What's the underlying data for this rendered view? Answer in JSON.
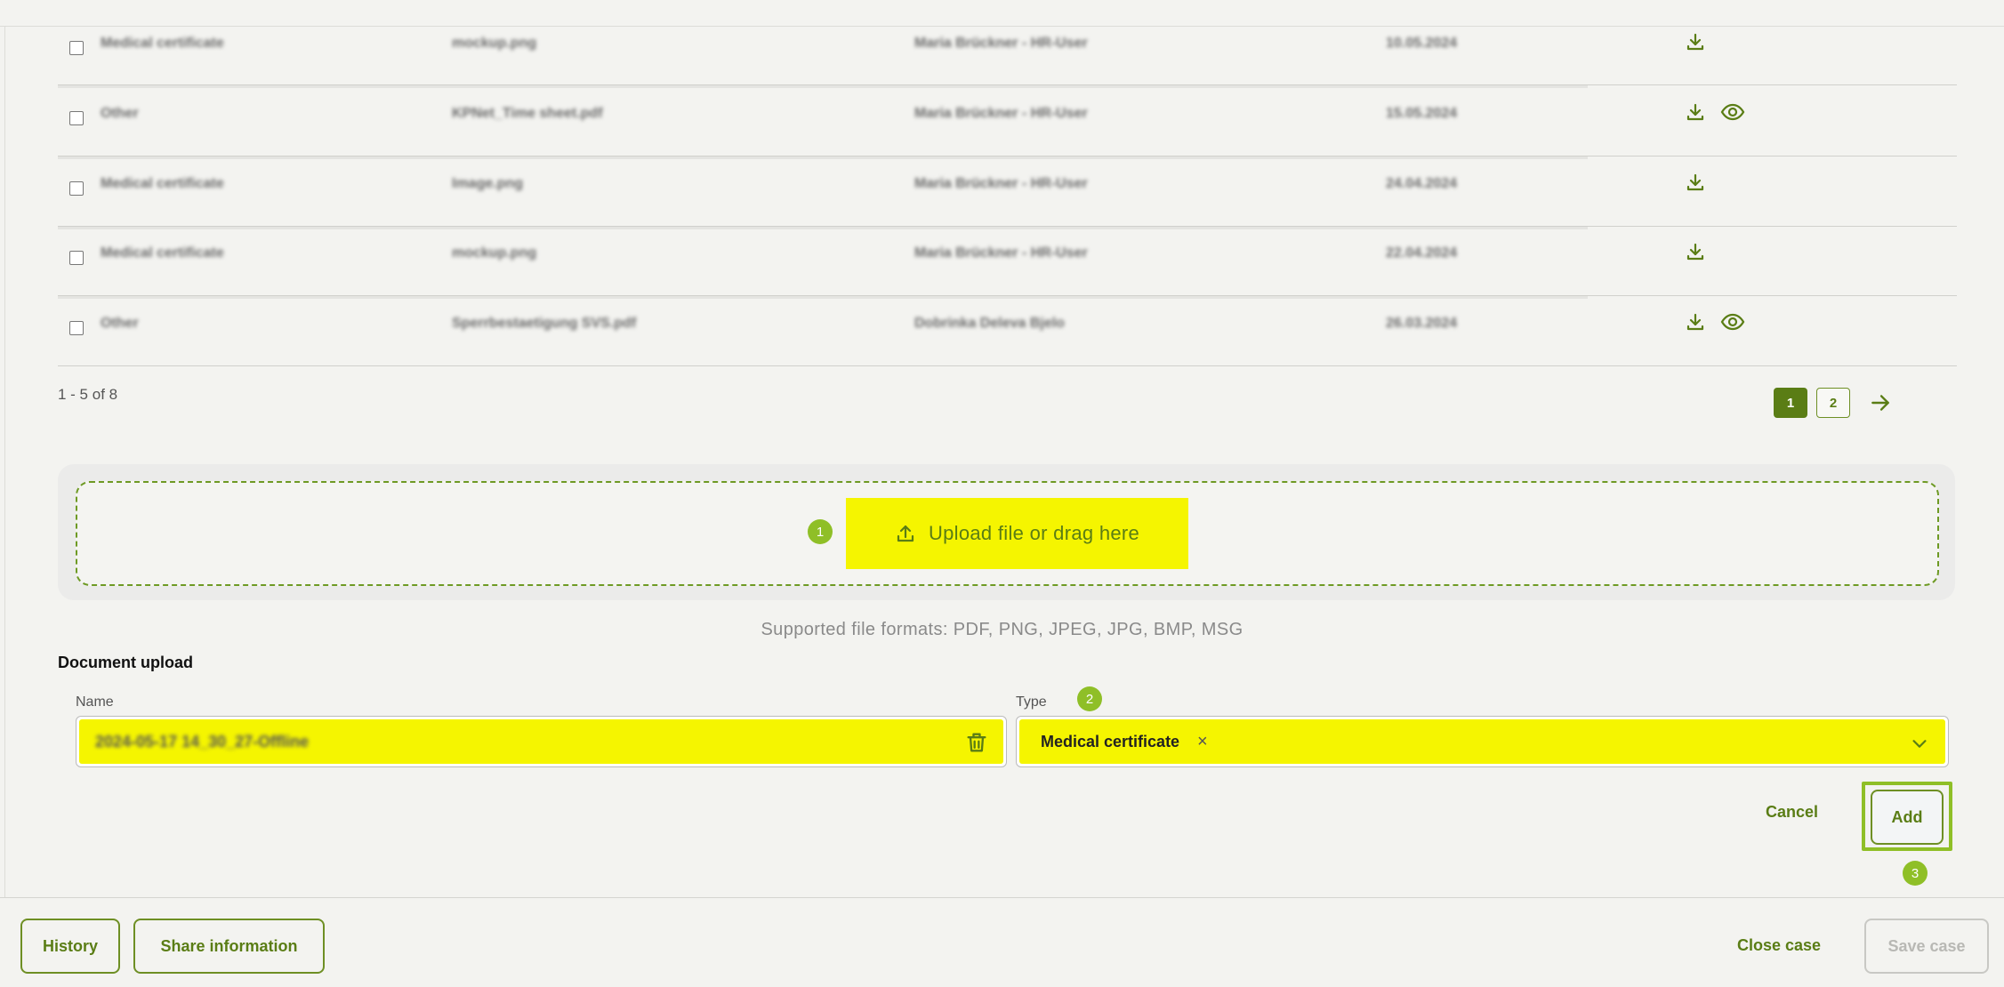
{
  "table": {
    "rows": [
      {
        "type": "Medical certificate",
        "file": "mockup.png",
        "user": "Maria Brückner - HR-User",
        "date": "10.05.2024",
        "preview": false
      },
      {
        "type": "Other",
        "file": "KPNet_Time sheet.pdf",
        "user": "Maria Brückner - HR-User",
        "date": "15.05.2024",
        "preview": true
      },
      {
        "type": "Medical certificate",
        "file": "Image.png",
        "user": "Maria Brückner - HR-User",
        "date": "24.04.2024",
        "preview": false
      },
      {
        "type": "Medical certificate",
        "file": "mockup.png",
        "user": "Maria Brückner - HR-User",
        "date": "22.04.2024",
        "preview": false
      },
      {
        "type": "Other",
        "file": "Sperrbestaetigung SVS.pdf",
        "user": "Dobrinka Deleva Bjelo",
        "date": "26.03.2024",
        "preview": true
      }
    ],
    "range_text": "1 - 5 of 8",
    "pages": [
      "1",
      "2"
    ]
  },
  "upload": {
    "button_label": "Upload file or drag here",
    "formats": "Supported file formats: PDF, PNG, JPEG, JPG, BMP, MSG"
  },
  "markers": {
    "m1": "1",
    "m2": "2",
    "m3": "3"
  },
  "document_upload": {
    "title": "Document upload",
    "name_label": "Name",
    "name_value": "2024-05-17 14_30_27-Offline",
    "type_label": "Type",
    "type_value": "Medical certificate",
    "type_clear": "×"
  },
  "actions": {
    "cancel": "Cancel",
    "add": "Add"
  },
  "footer": {
    "history": "History",
    "share": "Share information",
    "close_case": "Close case",
    "save_case": "Save case"
  },
  "colors": {
    "accent": "#5a7d15",
    "highlight": "#f5f500",
    "marker": "#8fbf27"
  },
  "icons": [
    "download-icon",
    "eye-icon",
    "upload-icon",
    "trash-icon",
    "chevron-down-icon",
    "arrow-right-icon"
  ]
}
